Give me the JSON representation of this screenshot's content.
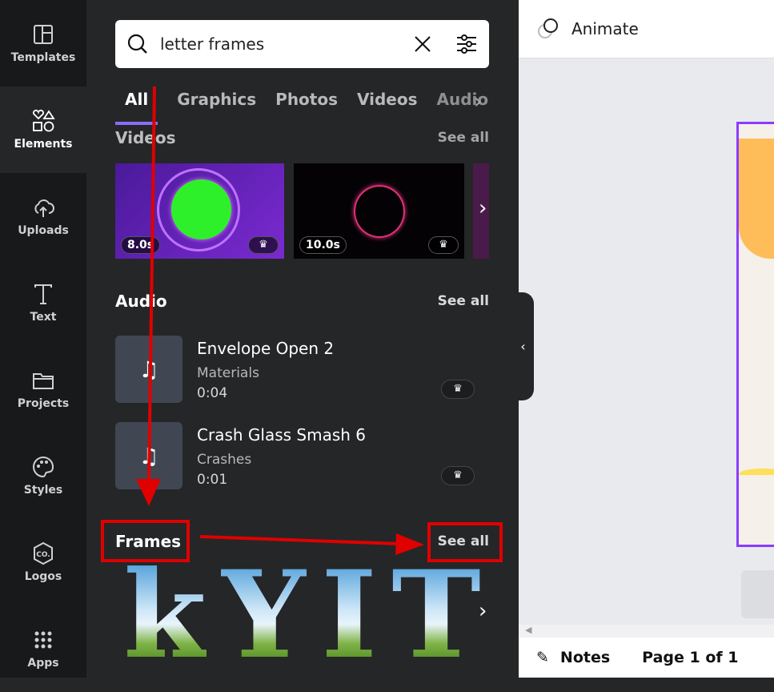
{
  "sidebar": {
    "items": [
      {
        "label": "Templates",
        "icon": "templates-icon"
      },
      {
        "label": "Elements",
        "icon": "elements-icon",
        "active": true
      },
      {
        "label": "Uploads",
        "icon": "upload-cloud-icon"
      },
      {
        "label": "Text",
        "icon": "text-icon"
      },
      {
        "label": "Projects",
        "icon": "folder-icon"
      },
      {
        "label": "Styles",
        "icon": "palette-icon"
      },
      {
        "label": "Logos",
        "icon": "logo-co-icon",
        "glyph": "CO."
      },
      {
        "label": "Apps",
        "icon": "apps-grid-icon"
      }
    ]
  },
  "search": {
    "value": "letter frames"
  },
  "tabs": [
    "All",
    "Graphics",
    "Photos",
    "Videos",
    "Audio"
  ],
  "videos": {
    "title": "Videos",
    "see_all": "See all",
    "items": [
      {
        "duration": "8.0s"
      },
      {
        "duration": "10.0s"
      }
    ]
  },
  "audio": {
    "title": "Audio",
    "see_all": "See all",
    "items": [
      {
        "name": "Envelope Open 2",
        "category": "Materials",
        "duration": "0:04"
      },
      {
        "name": "Crash Glass Smash 6",
        "category": "Crashes",
        "duration": "0:01"
      }
    ]
  },
  "frames": {
    "title": "Frames",
    "see_all": "See all",
    "letters": [
      "k",
      "Y",
      "I",
      "T"
    ]
  },
  "canvas": {
    "animate_label": "Animate",
    "notes_label": "Notes",
    "page_indicator": "Page 1 of 1"
  },
  "colors": {
    "accent": "#8b6cf7",
    "annotation": "#e00000",
    "selection": "#8b3cff"
  }
}
